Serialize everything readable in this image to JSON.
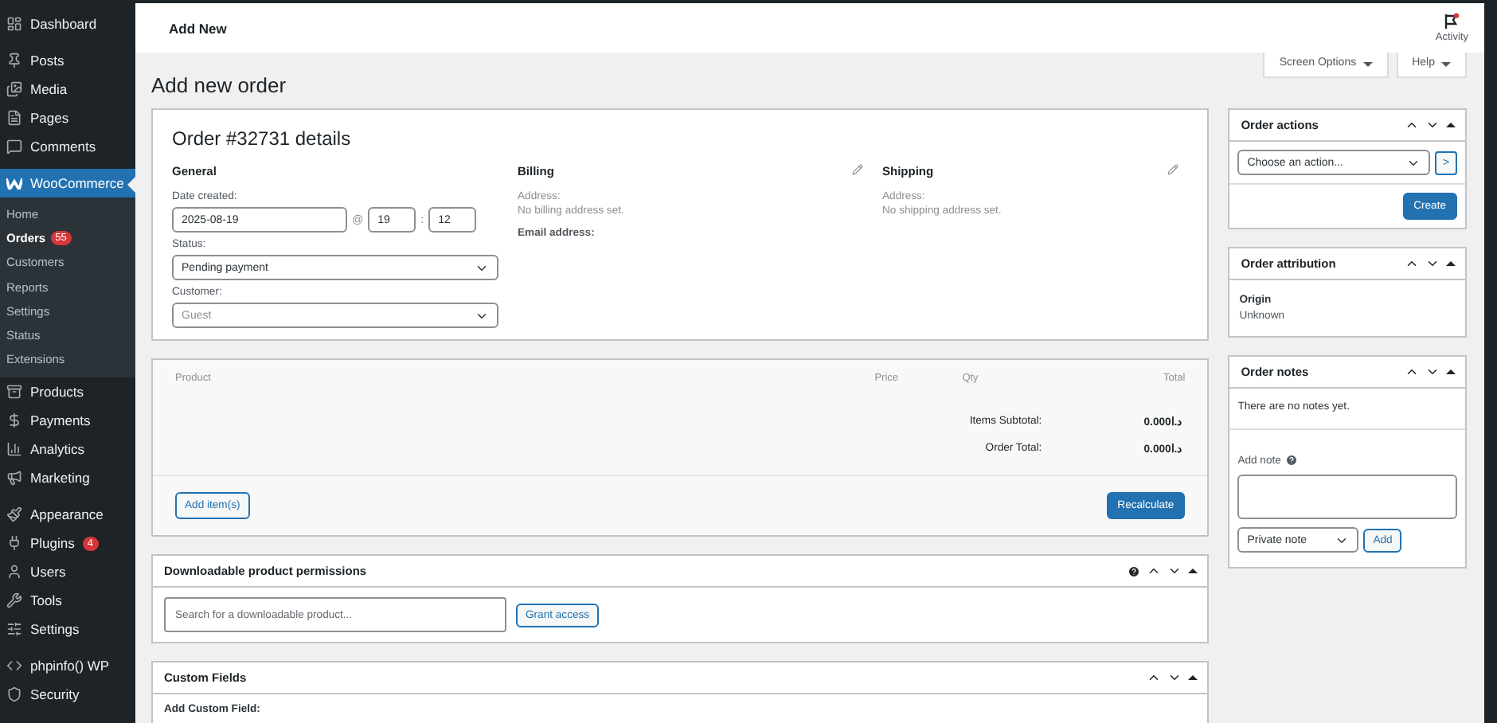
{
  "sidebar": {
    "groups": [
      [
        {
          "label": "Dashboard",
          "selected": false
        }
      ],
      [
        {
          "label": "Posts",
          "selected": false
        },
        {
          "label": "Media",
          "selected": false
        },
        {
          "label": "Pages",
          "selected": false
        },
        {
          "label": "Comments",
          "selected": false
        }
      ],
      [
        {
          "label": "WooCommerce",
          "selected": true,
          "children": [
            {
              "label": "Home",
              "selected": false
            },
            {
              "label": "Orders",
              "selected": true,
              "badge": "55"
            },
            {
              "label": "Customers",
              "selected": false
            },
            {
              "label": "Reports",
              "selected": false
            },
            {
              "label": "Settings",
              "selected": false
            },
            {
              "label": "Status",
              "selected": false
            },
            {
              "label": "Extensions",
              "selected": false
            }
          ]
        },
        {
          "label": "Products",
          "selected": false
        },
        {
          "label": "Payments",
          "selected": false
        },
        {
          "label": "Analytics",
          "selected": false
        },
        {
          "label": "Marketing",
          "selected": false
        }
      ],
      [
        {
          "label": "Appearance",
          "selected": false
        },
        {
          "label": "Plugins",
          "selected": false,
          "badge": "4"
        },
        {
          "label": "Users",
          "selected": false
        },
        {
          "label": "Tools",
          "selected": false
        },
        {
          "label": "Settings",
          "selected": false
        }
      ],
      [
        {
          "label": "phpinfo() WP",
          "selected": false
        },
        {
          "label": "Security",
          "selected": false
        }
      ]
    ]
  },
  "top_bar": {
    "title": "Add New",
    "activity": "Activity"
  },
  "screen_tabs": [
    "Screen Options",
    "Help"
  ],
  "page_title": "Add new order",
  "order_details": {
    "title": "Order #32731 details",
    "general": {
      "heading": "General",
      "date_label": "Date created:",
      "date": "2025-08-19",
      "at": "@",
      "hour": "19",
      "separator": ":",
      "minute": "12",
      "status_label": "Status:",
      "status": "Pending payment",
      "customer_label": "Customer:",
      "customer_placeholder": "Guest"
    },
    "billing": {
      "heading": "Billing",
      "address_label": "Address:",
      "address": "No billing address set.",
      "email_label": "Email address:"
    },
    "shipping": {
      "heading": "Shipping",
      "address_label": "Address:",
      "address": "No shipping address set."
    }
  },
  "items": {
    "columns": [
      "Product",
      "Price",
      "Qty",
      "Total"
    ],
    "totals": [
      {
        "label": "Items Subtotal:",
        "value": "0.000د.ا"
      },
      {
        "label": "Order Total:",
        "value": "0.000د.ا"
      }
    ],
    "add_button": "Add item(s)",
    "recalculate_button": "Recalculate"
  },
  "downloads": {
    "title": "Downloadable product permissions",
    "search_placeholder": "Search for a downloadable product...",
    "grant_button": "Grant access"
  },
  "custom_fields": {
    "title": "Custom Fields",
    "add_label": "Add Custom Field:"
  },
  "order_actions": {
    "title": "Order actions",
    "select": "Choose an action...",
    "go": ">",
    "create_button": "Create"
  },
  "attribution": {
    "title": "Order attribution",
    "origin_label": "Origin",
    "origin": "Unknown"
  },
  "notes": {
    "title": "Order notes",
    "empty": "There are no notes yet.",
    "add_label": "Add note",
    "type": "Private note",
    "add_button": "Add"
  }
}
